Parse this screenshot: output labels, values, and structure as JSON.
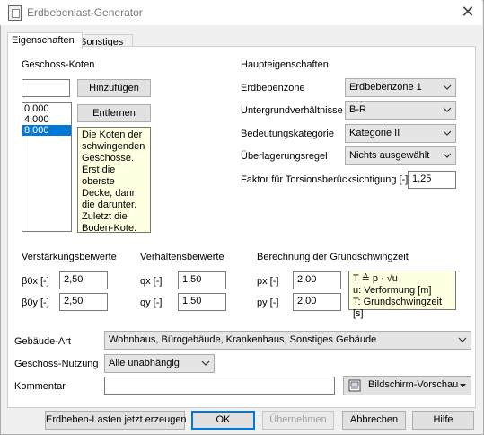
{
  "window": {
    "title": "Erdbebenlast-Generator",
    "close_symbol": "✕"
  },
  "tabs": [
    {
      "label": "Eigenschaften"
    },
    {
      "label": "Sonstiges"
    }
  ],
  "geschoss": {
    "heading": "Geschoss-Koten",
    "input_value": "",
    "add_label": "Hinzufügen",
    "remove_label": "Entfernen",
    "items": [
      "0,000",
      "4,000",
      "8,000"
    ],
    "selected_item": "8,000",
    "hint_lines": [
      "Die Koten der",
      "schwingenden",
      "Geschosse.",
      "Erst die oberste",
      "Decke, dann",
      "die darunter.",
      "Zuletzt die",
      "Boden-Kote."
    ]
  },
  "haupt": {
    "heading": "Haupteigenschaften",
    "erdbebenzone_label": "Erdbebenzone",
    "erdbebenzone_value": "Erdbebenzone 1",
    "untergrund_label": "Untergrundverhältnisse",
    "untergrund_value": "B-R",
    "bedeutung_label": "Bedeutungskategorie",
    "bedeutung_value": "Kategorie II",
    "ueberlagerung_label": "Überlagerungsregel",
    "ueberlagerung_value": "Nichts ausgewählt",
    "torsion_label": "Faktor für Torsionsberücksichtigung [-]",
    "torsion_value": "1,25"
  },
  "verstaerkung": {
    "heading": "Verstärkungsbeiwerte",
    "b0x_label": "β0x [-]",
    "b0x_value": "2,50",
    "b0y_label": "β0y [-]",
    "b0y_value": "2,50"
  },
  "verhalten": {
    "heading": "Verhaltensbeiwerte",
    "qx_label": "qx [-]",
    "qx_value": "1,50",
    "qy_label": "qy [-]",
    "qy_value": "1,50"
  },
  "grundschwing": {
    "heading": "Berechnung der Grundschwingzeit",
    "px_label": "px [-]",
    "px_value": "2,00",
    "py_label": "py [-]",
    "py_value": "2,00",
    "formula_lines": [
      "T ≙ p · √u",
      "u: Verformung [m]",
      "T: Grundschwingzeit [s]"
    ]
  },
  "gebaeude": {
    "art_label": "Gebäude-Art",
    "art_value": "Wohnhaus, Bürogebäude, Krankenhaus, Sonstiges Gebäude",
    "nutzung_label": "Geschoss-Nutzung",
    "nutzung_value": "Alle unabhängig",
    "kommentar_label": "Kommentar",
    "kommentar_value": "",
    "preview_label": "Bildschirm-Vorschau"
  },
  "footer": {
    "generate_label": "Erdbeben-Lasten jetzt erzeugen",
    "ok_label": "OK",
    "apply_label": "Übernehmen",
    "cancel_label": "Abbrechen",
    "help_label": "Hilfe"
  }
}
